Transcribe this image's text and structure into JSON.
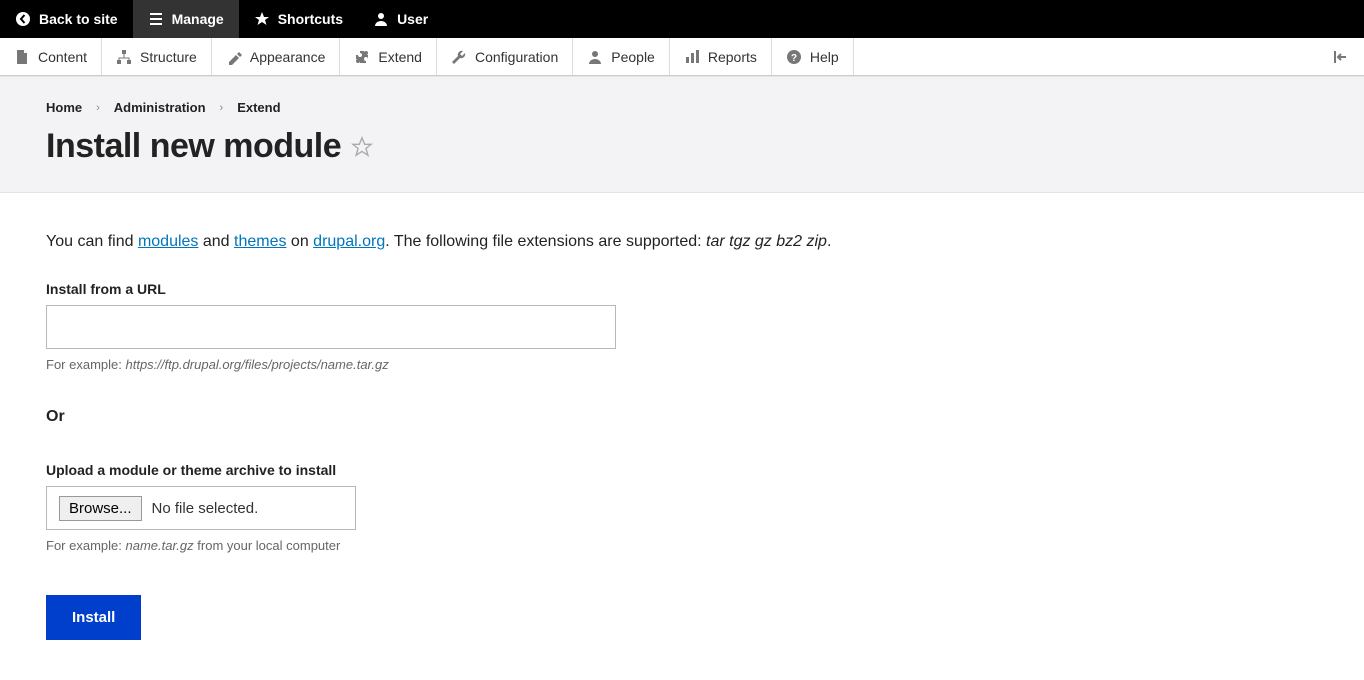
{
  "topbar": {
    "back": "Back to site",
    "manage": "Manage",
    "shortcuts": "Shortcuts",
    "user": "User"
  },
  "adminMenu": {
    "content": "Content",
    "structure": "Structure",
    "appearance": "Appearance",
    "extend": "Extend",
    "configuration": "Configuration",
    "people": "People",
    "reports": "Reports",
    "help": "Help"
  },
  "breadcrumb": {
    "home": "Home",
    "admin": "Administration",
    "extend": "Extend"
  },
  "pageTitle": "Install new module",
  "intro": {
    "prefix": "You can find ",
    "modules": "modules",
    "and": " and ",
    "themes": "themes",
    "on": " on ",
    "drupalorg": "drupal.org",
    "suffix": ". The following file extensions are supported: ",
    "ext": "tar tgz gz bz2 zip",
    "period": "."
  },
  "urlField": {
    "label": "Install from a URL",
    "descPrefix": "For example: ",
    "descExample": "https://ftp.drupal.org/files/projects/name.tar.gz"
  },
  "or": "Or",
  "fileField": {
    "label": "Upload a module or theme archive to install",
    "browse": "Browse...",
    "noFile": "No file selected.",
    "descPrefix": "For example: ",
    "descExample": "name.tar.gz",
    "descSuffix": " from your local computer"
  },
  "submit": "Install"
}
